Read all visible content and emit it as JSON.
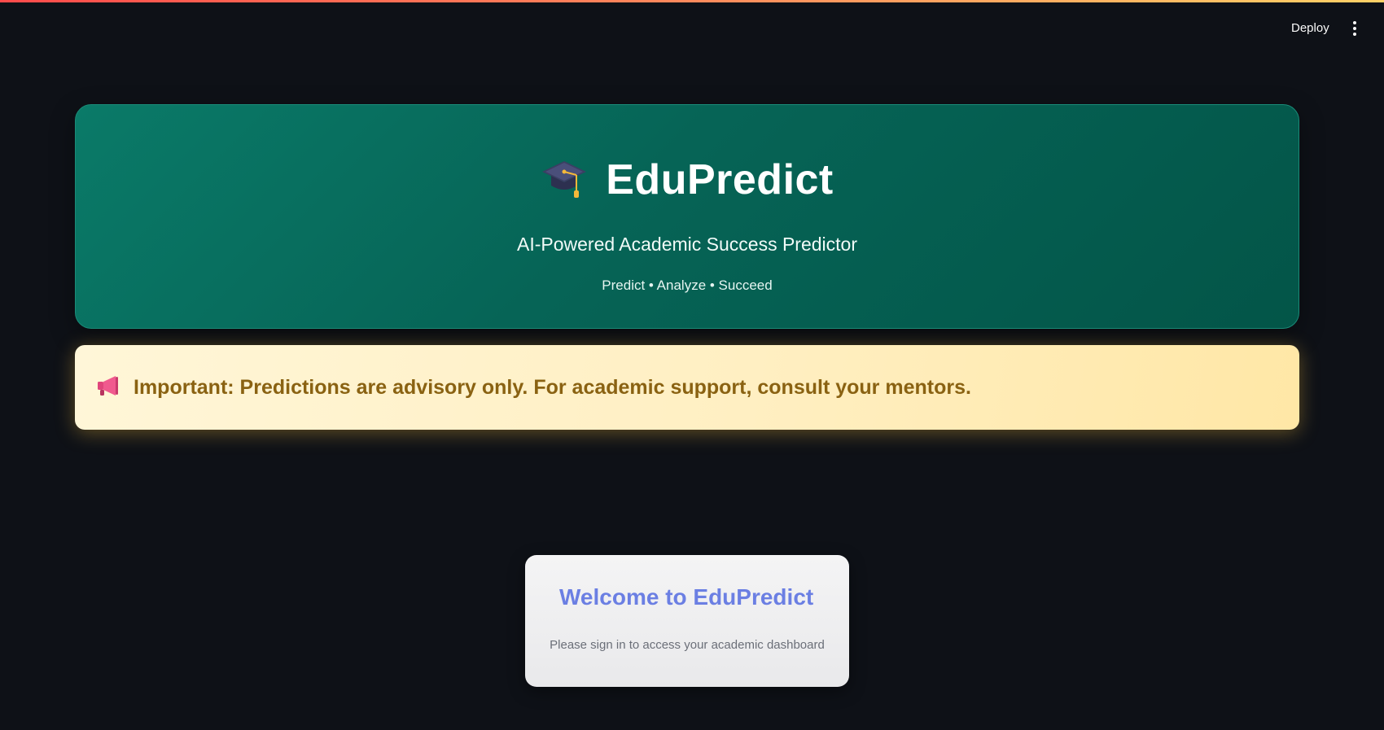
{
  "header": {
    "deploy_label": "Deploy",
    "menu_icon": "vertical-dots-icon"
  },
  "hero": {
    "icon": "graduation-cap-icon",
    "title": "EduPredict",
    "subtitle": "AI-Powered Academic Success Predictor",
    "tagline": "Predict • Analyze • Succeed"
  },
  "notice": {
    "icon": "megaphone-icon",
    "text": "Important: Predictions are advisory only. For academic support, consult your mentors."
  },
  "login": {
    "title": "Welcome to EduPredict",
    "message": "Please sign in to access your academic dashboard"
  },
  "colors": {
    "hero_bg": "#066456",
    "notice_bg": "#ffefc2",
    "notice_text": "#8a6212",
    "login_title": "#6b7fe3",
    "page_bg": "#0e1117"
  }
}
